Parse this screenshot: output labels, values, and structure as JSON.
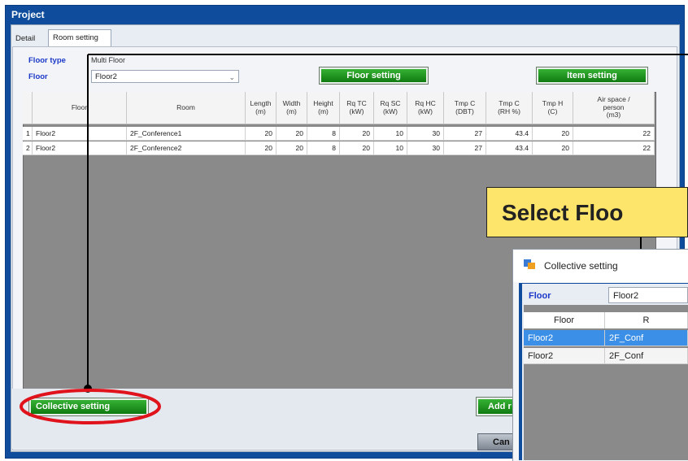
{
  "window": {
    "title": "Project"
  },
  "tabs": [
    {
      "label": "Detail"
    },
    {
      "label": "Room setting"
    }
  ],
  "controls": {
    "floor_type_label": "Floor type",
    "floor_type_value": "Multi Floor",
    "floor_label": "Floor",
    "floor_value": "Floor2",
    "floor_setting_button": "Floor setting",
    "item_setting_button": "Item setting",
    "collective_setting_button": "Collective setting",
    "add_button": "Add r",
    "cancel_button": "Can"
  },
  "table": {
    "headers": [
      "",
      "Floor",
      "Room",
      "Length\n(m)",
      "Width\n(m)",
      "Height\n(m)",
      "Rq TC\n(kW)",
      "Rq SC\n(kW)",
      "Rq HC\n(kW)",
      "Tmp C\n(DBT)",
      "Tmp C\n(RH %)",
      "Tmp H\n(C)",
      "Air space /\nperson\n(m3)"
    ],
    "rows": [
      [
        "1",
        "Floor2",
        "2F_Conference1",
        "20",
        "20",
        "8",
        "20",
        "10",
        "30",
        "27",
        "43.4",
        "20",
        "22"
      ],
      [
        "2",
        "Floor2",
        "2F_Conference2",
        "20",
        "20",
        "8",
        "20",
        "10",
        "30",
        "27",
        "43.4",
        "20",
        "22"
      ]
    ]
  },
  "callout": {
    "text": "Select Floo"
  },
  "popup": {
    "title": "Collective setting",
    "floor_label": "Floor",
    "floor_value": "Floor2",
    "headers": [
      "Floor",
      "R"
    ],
    "rows": [
      [
        "Floor2",
        "2F_Conf"
      ],
      [
        "Floor2",
        "2F_Conf"
      ]
    ]
  },
  "colors": {
    "accent_green": "#1a9a1c",
    "highlight_red": "#e0121b",
    "selected_row": "#3b8fe6",
    "callout_yellow": "#fde46a"
  },
  "icons": [
    "app-icon",
    "chevron-down-icon"
  ]
}
